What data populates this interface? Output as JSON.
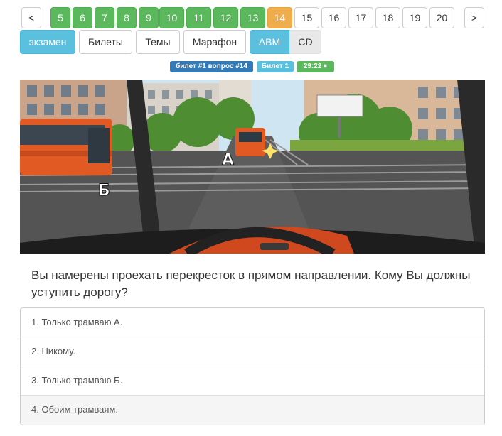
{
  "pagination": {
    "prev_label": "<",
    "next_label": ">",
    "pages": [
      "5",
      "6",
      "7",
      "8",
      "9",
      "10",
      "11",
      "12",
      "13",
      "14",
      "15",
      "16",
      "17",
      "18",
      "19",
      "20"
    ],
    "current_page": "14",
    "answered_color": "#5cb85c",
    "current_color": "#f0ad4e"
  },
  "modes": {
    "exam": "экзамен",
    "tickets": "Билеты",
    "topics": "Темы",
    "marathon": "Марафон",
    "category_abm": "ABM",
    "category_cd": "CD"
  },
  "badges": {
    "ticket_question": "билет #1 вопрос #14",
    "ticket": "Билет 1",
    "timer": "29:22 ⏸"
  },
  "scene": {
    "label_a": "А",
    "label_b": "Б"
  },
  "question": {
    "text": "Вы намерены проехать перекресток в прямом направлении. Кому Вы должны уступить дорогу?"
  },
  "answers": [
    "1. Только трамваю А.",
    "2. Никому.",
    "3. Только трамваю Б.",
    "4. Обоим трамваям."
  ]
}
